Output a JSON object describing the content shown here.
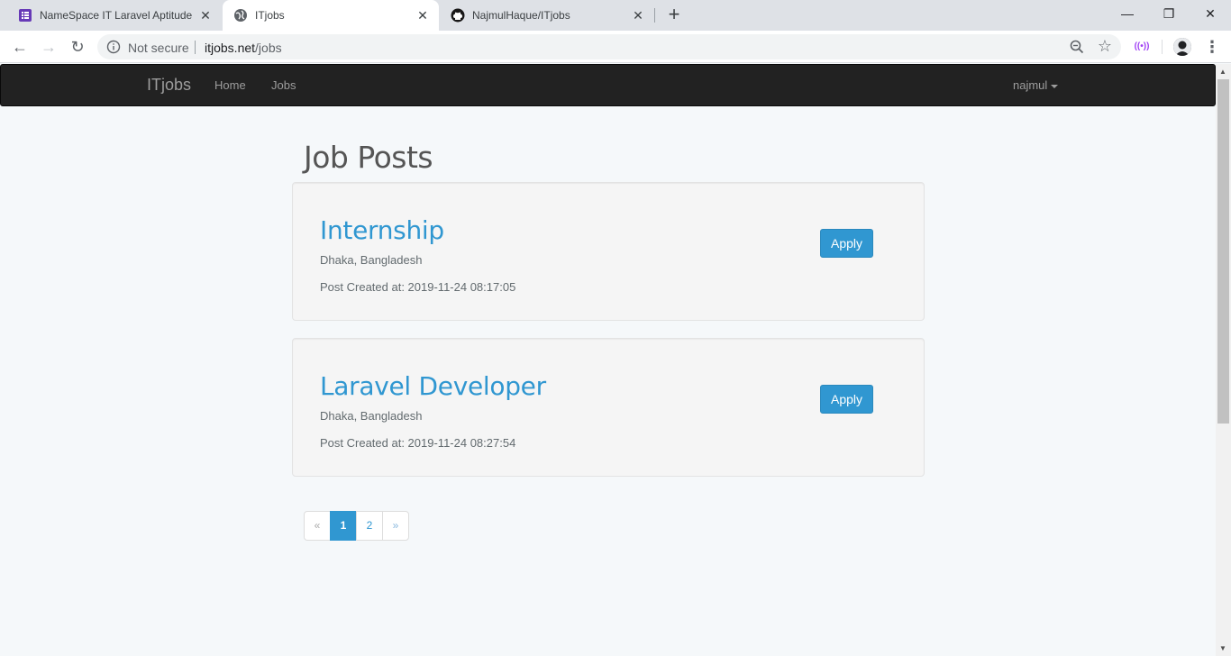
{
  "browser": {
    "tabs": [
      {
        "title": "NameSpace IT Laravel Aptitude T",
        "icon": "forms-icon"
      },
      {
        "title": "ITjobs",
        "icon": "globe-icon"
      },
      {
        "title": "NajmulHaque/ITjobs",
        "icon": "github-icon"
      }
    ],
    "new_tab": "+",
    "security_label": "Not secure",
    "url_host": "itjobs.net",
    "url_path": "/jobs"
  },
  "navbar": {
    "brand": "ITjobs",
    "links": [
      "Home",
      "Jobs"
    ],
    "user": "najmul"
  },
  "main": {
    "title": "Job Posts",
    "jobs": [
      {
        "title": "Internship",
        "location": "Dhaka, Bangladesh",
        "created": "Post Created at: 2019-11-24 08:17:05",
        "apply": "Apply"
      },
      {
        "title": "Laravel Developer",
        "location": "Dhaka, Bangladesh",
        "created": "Post Created at: 2019-11-24 08:27:54",
        "apply": "Apply"
      }
    ],
    "pagination": {
      "prev": "«",
      "pages": [
        "1",
        "2"
      ],
      "active": "1",
      "next": "»"
    }
  },
  "colors": {
    "accent": "#3097d1",
    "navbar_bg": "#222222",
    "page_bg": "#f5f8fa"
  }
}
